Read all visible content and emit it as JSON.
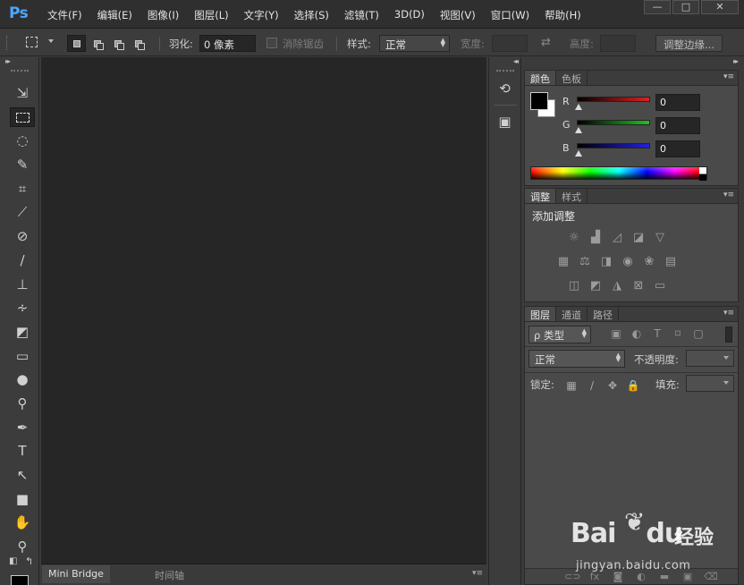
{
  "app": {
    "logo": "Ps"
  },
  "menu": [
    "文件(F)",
    "编辑(E)",
    "图像(I)",
    "图层(L)",
    "文字(Y)",
    "选择(S)",
    "滤镜(T)",
    "3D(D)",
    "视图(V)",
    "窗口(W)",
    "帮助(H)"
  ],
  "window_controls": {
    "minimize": "—",
    "maximize": "□",
    "close": "✕"
  },
  "options": {
    "feather_label": "羽化:",
    "feather_value": "0 像素",
    "antialias_label": "消除锯齿",
    "style_label": "样式:",
    "style_value": "正常",
    "width_label": "宽度:",
    "height_label": "高度:",
    "refine_edge": "调整边缘..."
  },
  "bottom_tabs": [
    "Mini Bridge",
    "时间轴"
  ],
  "color_panel": {
    "tabs": [
      "颜色",
      "色板"
    ],
    "channels": [
      {
        "label": "R",
        "value": "0",
        "color": "#e02020"
      },
      {
        "label": "G",
        "value": "0",
        "color": "#20c020"
      },
      {
        "label": "B",
        "value": "0",
        "color": "#2020e0"
      }
    ]
  },
  "adjustments_panel": {
    "tabs": [
      "调整",
      "样式"
    ],
    "title": "添加调整"
  },
  "layers_panel": {
    "tabs": [
      "图层",
      "通道",
      "路径"
    ],
    "filter_kind": "ρ 类型",
    "blend_mode": "正常",
    "opacity_label": "不透明度:",
    "lock_label": "锁定:",
    "fill_label": "填充:"
  },
  "watermark": {
    "brand": "Bai",
    "brand2": "du",
    "cn": "经验",
    "url": "jingyan.baidu.com"
  }
}
